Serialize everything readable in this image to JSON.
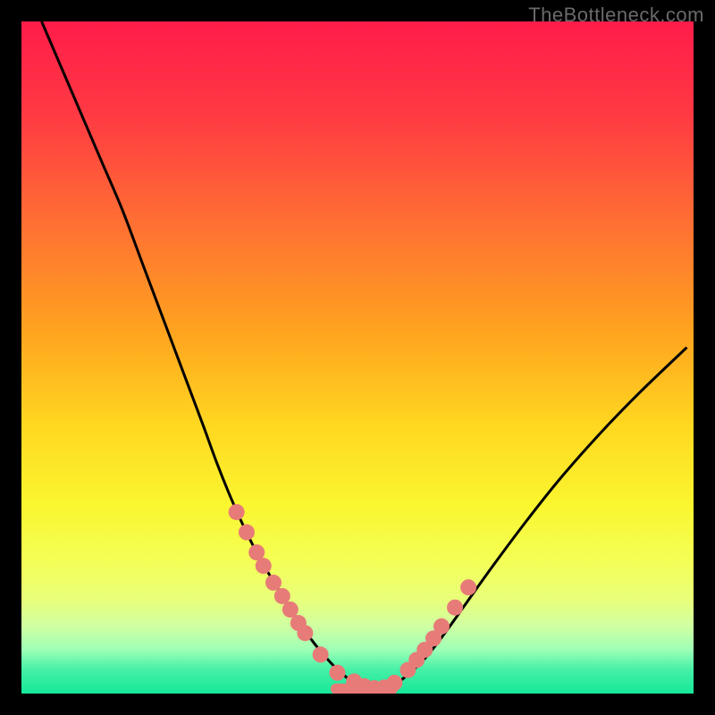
{
  "watermark": "TheBottleneck.com",
  "colors": {
    "marker": "#e77b78",
    "curve": "#000000",
    "gradient_stops": [
      {
        "pct": 0.0,
        "color": "#ff1c4a"
      },
      {
        "pct": 0.14,
        "color": "#ff3a43"
      },
      {
        "pct": 0.3,
        "color": "#ff6f33"
      },
      {
        "pct": 0.46,
        "color": "#ffa31f"
      },
      {
        "pct": 0.6,
        "color": "#ffd720"
      },
      {
        "pct": 0.72,
        "color": "#faf62f"
      },
      {
        "pct": 0.8,
        "color": "#f4ff55"
      },
      {
        "pct": 0.86,
        "color": "#e9ff7a"
      },
      {
        "pct": 0.9,
        "color": "#cfffa2"
      },
      {
        "pct": 0.935,
        "color": "#9dffb6"
      },
      {
        "pct": 0.965,
        "color": "#44f0a6"
      },
      {
        "pct": 1.0,
        "color": "#16e79a"
      }
    ]
  },
  "chart_data": {
    "type": "line",
    "title": "",
    "xlabel": "",
    "ylabel": "",
    "xlim": [
      0,
      100
    ],
    "ylim": [
      0,
      100
    ],
    "x": [
      3,
      6,
      9,
      12,
      15,
      18,
      21,
      24,
      27,
      29,
      31,
      33,
      35,
      37,
      38.5,
      40,
      41.5,
      43,
      44.5,
      46,
      47.5,
      49,
      51,
      53,
      55,
      57,
      60,
      63,
      66,
      70,
      75,
      80,
      86,
      92,
      99
    ],
    "values": [
      100,
      93,
      86,
      79,
      72,
      64,
      56,
      48,
      40,
      34.5,
      29.5,
      25,
      21,
      17.5,
      15,
      12.5,
      10.3,
      8.2,
      6.3,
      4.6,
      3.1,
      2.0,
      1.1,
      0.6,
      1.1,
      2.4,
      5.2,
      9.0,
      13.2,
      18.8,
      25.5,
      31.8,
      38.6,
      44.8,
      51.5
    ],
    "markers": {
      "x": [
        32,
        33.5,
        35,
        36,
        37.5,
        38.8,
        40,
        41.2,
        42.2,
        44.5,
        47,
        49.5,
        51,
        52.5,
        54,
        55.5,
        57.5,
        58.8,
        60,
        61.3,
        62.5,
        64.5,
        66.5
      ],
      "y": [
        27,
        24,
        21,
        19,
        16.5,
        14.5,
        12.5,
        10.5,
        9.0,
        5.8,
        3.1,
        1.8,
        1.1,
        0.8,
        0.9,
        1.6,
        3.5,
        5.0,
        6.5,
        8.2,
        10.0,
        12.8,
        15.8
      ]
    },
    "bottom_segment": {
      "x0": 46,
      "x1": 56,
      "y": 0.7
    }
  }
}
